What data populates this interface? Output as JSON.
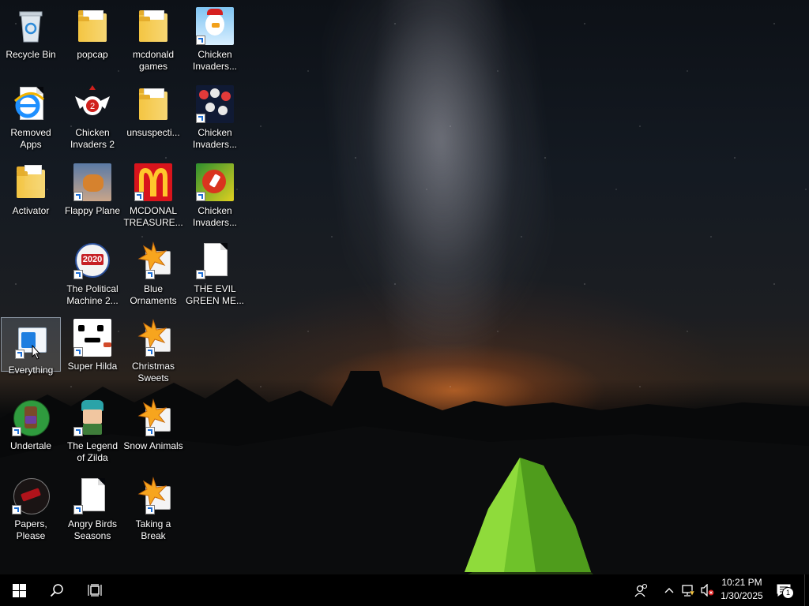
{
  "desktop": {
    "icons": [
      {
        "label": "Recycle Bin",
        "icon": "recycle-bin-icon"
      },
      {
        "label": "popcap",
        "icon": "folder-icon"
      },
      {
        "label": "mcdonald games",
        "icon": "folder-icon"
      },
      {
        "label": "Chicken Invaders...",
        "icon": "chicken-invaders-icon"
      },
      {
        "label": "Removed Apps",
        "icon": "internet-explorer-icon"
      },
      {
        "label": "Chicken Invaders 2",
        "icon": "chicken-invaders-2-icon"
      },
      {
        "label": "unsuspecti...",
        "icon": "folder-icon"
      },
      {
        "label": "Chicken Invaders...",
        "icon": "chicken-invaders-icon"
      },
      {
        "label": "Activator",
        "icon": "folder-icon"
      },
      {
        "label": "Flappy Plane",
        "icon": "flappy-plane-icon"
      },
      {
        "label": "MCDONAL TREASURE...",
        "icon": "mcdonalds-icon"
      },
      {
        "label": "Chicken Invaders...",
        "icon": "chicken-invaders-icon"
      },
      {
        "label": "The Political Machine 2...",
        "icon": "political-machine-icon"
      },
      {
        "label": "Blue Ornaments",
        "icon": "popcap-game-icon"
      },
      {
        "label": "THE EVIL GREEN ME...",
        "icon": "document-icon"
      },
      {
        "label": "Everything",
        "icon": "everything-search-icon"
      },
      {
        "label": "Super Hilda",
        "icon": "super-hilda-icon"
      },
      {
        "label": "Christmas Sweets",
        "icon": "popcap-game-icon"
      },
      {
        "label": "Undertale",
        "icon": "undertale-icon"
      },
      {
        "label": "The Legend of Zilda",
        "icon": "legend-of-zilda-icon"
      },
      {
        "label": "Snow Animals",
        "icon": "popcap-game-icon"
      },
      {
        "label": "Papers, Please",
        "icon": "papers-please-icon"
      },
      {
        "label": "Angry Birds Seasons",
        "icon": "document-icon"
      },
      {
        "label": "Taking a Break",
        "icon": "popcap-game-icon"
      }
    ],
    "selected": "Everything"
  },
  "taskbar": {
    "clock": {
      "time": "10:21 PM",
      "date": "1/30/2025"
    },
    "notifications_count": "1",
    "icons": [
      "windows-start-icon",
      "search-icon",
      "task-view-icon",
      "people-icon",
      "chevron-up-icon",
      "network-icon",
      "volume-muted-icon",
      "action-center-icon"
    ]
  },
  "colors": {
    "taskbar": "#000000",
    "selection": "#c8d7eb",
    "accent": "#1d6fd6"
  }
}
